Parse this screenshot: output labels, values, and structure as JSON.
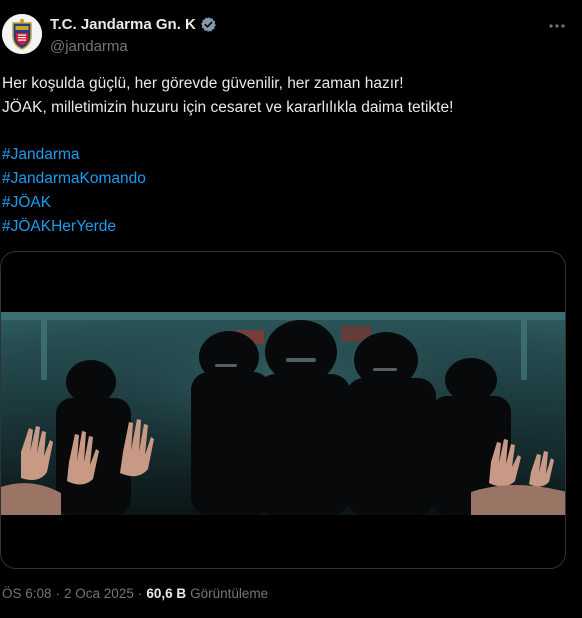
{
  "account": {
    "display_name": "T.C. Jandarma Gn. K",
    "handle": "@jandarma",
    "verified_icon": "verified-badge-icon",
    "avatar_icon": "jandarma-emblem"
  },
  "tweet": {
    "line1": "Her koşulda güçlü, her görevde güvenilir, her zaman hazır!",
    "line2": "JÖAK, milletimizin huzuru için cesaret ve kararlılıkla daima tetikte!",
    "hashtags": [
      "#Jandarma",
      "#JandarmaKomando",
      "#JÖAK",
      "#JÖAKHerYerde"
    ]
  },
  "meta": {
    "time": "ÖS 6:08",
    "sep1": "·",
    "date": "2 Oca 2025",
    "sep2": "·",
    "views_count": "60,6 B",
    "views_label": "Görüntüleme"
  },
  "colors": {
    "background": "#000000",
    "text": "#e7e9ea",
    "muted": "#71767b",
    "link": "#1d9bf0",
    "verified": "#829aab"
  }
}
